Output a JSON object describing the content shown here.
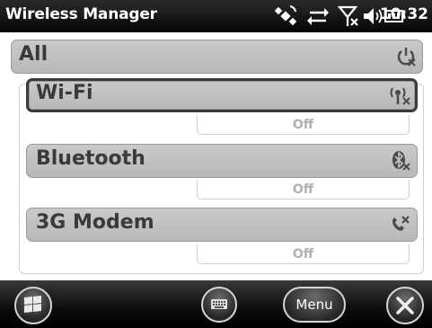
{
  "titlebar": {
    "title": "Wireless Manager",
    "time": "10:32",
    "icons": [
      "gps-icon",
      "connectivity-icon",
      "no-signal-icon",
      "volume-icon",
      "battery-icon"
    ]
  },
  "sections": {
    "all": {
      "label": "All",
      "icon": "power-icon"
    },
    "wifi": {
      "label": "Wi-Fi",
      "status": "Off",
      "icon": "wifi-disabled-icon"
    },
    "bluetooth": {
      "label": "Bluetooth",
      "status": "Off",
      "icon": "bluetooth-disabled-icon"
    },
    "modem": {
      "label": "3G Modem",
      "status": "Off",
      "icon": "phone-disabled-icon"
    }
  },
  "bottombar": {
    "start_icon": "windows-start-icon",
    "keyboard_icon": "keyboard-icon",
    "menu_label": "Menu",
    "close_icon": "close-icon"
  },
  "colors": {
    "bar_gray": "#c4c4c4",
    "title_bg": "#0a0a0a",
    "status_text": "#b0b0b0"
  }
}
